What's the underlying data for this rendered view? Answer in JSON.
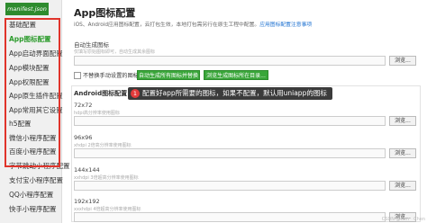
{
  "sidebar": {
    "file_tab": "manifest.json",
    "items": [
      {
        "label": "基础配置"
      },
      {
        "label": "App图标配置"
      },
      {
        "label": "App启动界面配置"
      },
      {
        "label": "App模块配置"
      },
      {
        "label": "App权限配置"
      },
      {
        "label": "App原生插件配置"
      },
      {
        "label": "App常用其它设置"
      },
      {
        "label": "h5配置"
      },
      {
        "label": "微信小程序配置"
      },
      {
        "label": "百度小程序配置"
      },
      {
        "label": "字节跳动小程序配置"
      },
      {
        "label": "支付宝小程序配置"
      },
      {
        "label": "QQ小程序配置"
      },
      {
        "label": "快手小程序配置"
      }
    ]
  },
  "main": {
    "title": "App图标配置",
    "desc": "iOS、Android应用图标配置，云打包生效，本地打包需另行在原生工程中配置。",
    "desc_link": "应用图标配置注意事项",
    "auto_label": "自动生成图标",
    "auto_hint": "仅填写原始图标即可，自动生成其余图标",
    "browse": "浏览...",
    "checkbox_label": "不替换手动设置的图标",
    "btn_generate": "自动生成所有图标并替换",
    "btn_browse_dir": "浏览生成图标所在目录...",
    "section_title": "Android图标配置",
    "tooltip_num": "1",
    "tooltip_text": "配置好app所需要的图标，如果不配置，默认用uniapp的图标",
    "fields": [
      {
        "label": "72x72",
        "hint": "hdpi高分辨率使用图标"
      },
      {
        "label": "96x96",
        "hint": "xhdpi 2倍高分辨率使用图标"
      },
      {
        "label": "144x144",
        "hint": "xxhdpi 3倍超高分辨率使用图标"
      },
      {
        "label": "192x192",
        "hint": "xxxhdpi 4倍超高分辨率使用图标"
      }
    ]
  },
  "watermark": "CSDN @Kim__Chen"
}
